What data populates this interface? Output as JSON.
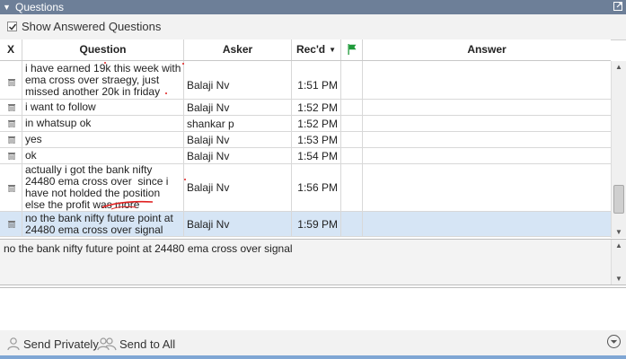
{
  "panel": {
    "title": "Questions"
  },
  "options": {
    "show_answered_label": "Show Answered Questions",
    "show_answered_checked": true
  },
  "columns": {
    "x": "X",
    "question": "Question",
    "asker": "Asker",
    "received": "Rec'd",
    "answer": "Answer"
  },
  "rows": [
    {
      "question": "i have earned 19k this week with ema cross over straegy, just missed another 20k in friday",
      "asker": "Balaji Nv",
      "received": "1:51 PM",
      "answer": ""
    },
    {
      "question": "i want to follow",
      "asker": "Balaji Nv",
      "received": "1:52 PM",
      "answer": ""
    },
    {
      "question": "in whatsup ok",
      "asker": "shankar p",
      "received": "1:52 PM",
      "answer": ""
    },
    {
      "question": "yes",
      "asker": "Balaji Nv",
      "received": "1:53 PM",
      "answer": ""
    },
    {
      "question": "ok",
      "asker": "Balaji Nv",
      "received": "1:54 PM",
      "answer": ""
    },
    {
      "question": "actually i got the bank nifty 24480 ema cross over  since i have not holded the position else the profit was more",
      "asker": "Balaji Nv",
      "received": "1:56 PM",
      "answer": ""
    },
    {
      "question": "no the bank nifty future point at 24480 ema cross over signal",
      "asker": "Balaji Nv",
      "received": "1:59 PM",
      "answer": "",
      "selected": true
    }
  ],
  "preview": {
    "text": "no the bank nifty future point at 24480 ema cross over signal"
  },
  "footer": {
    "send_privately": "Send Privately",
    "send_to_all": "Send to All"
  },
  "colors": {
    "titlebar": "#6d7f98",
    "selected_row": "#d6e5f5",
    "flag": "#1f9a3a",
    "annotation": "#e02020"
  }
}
